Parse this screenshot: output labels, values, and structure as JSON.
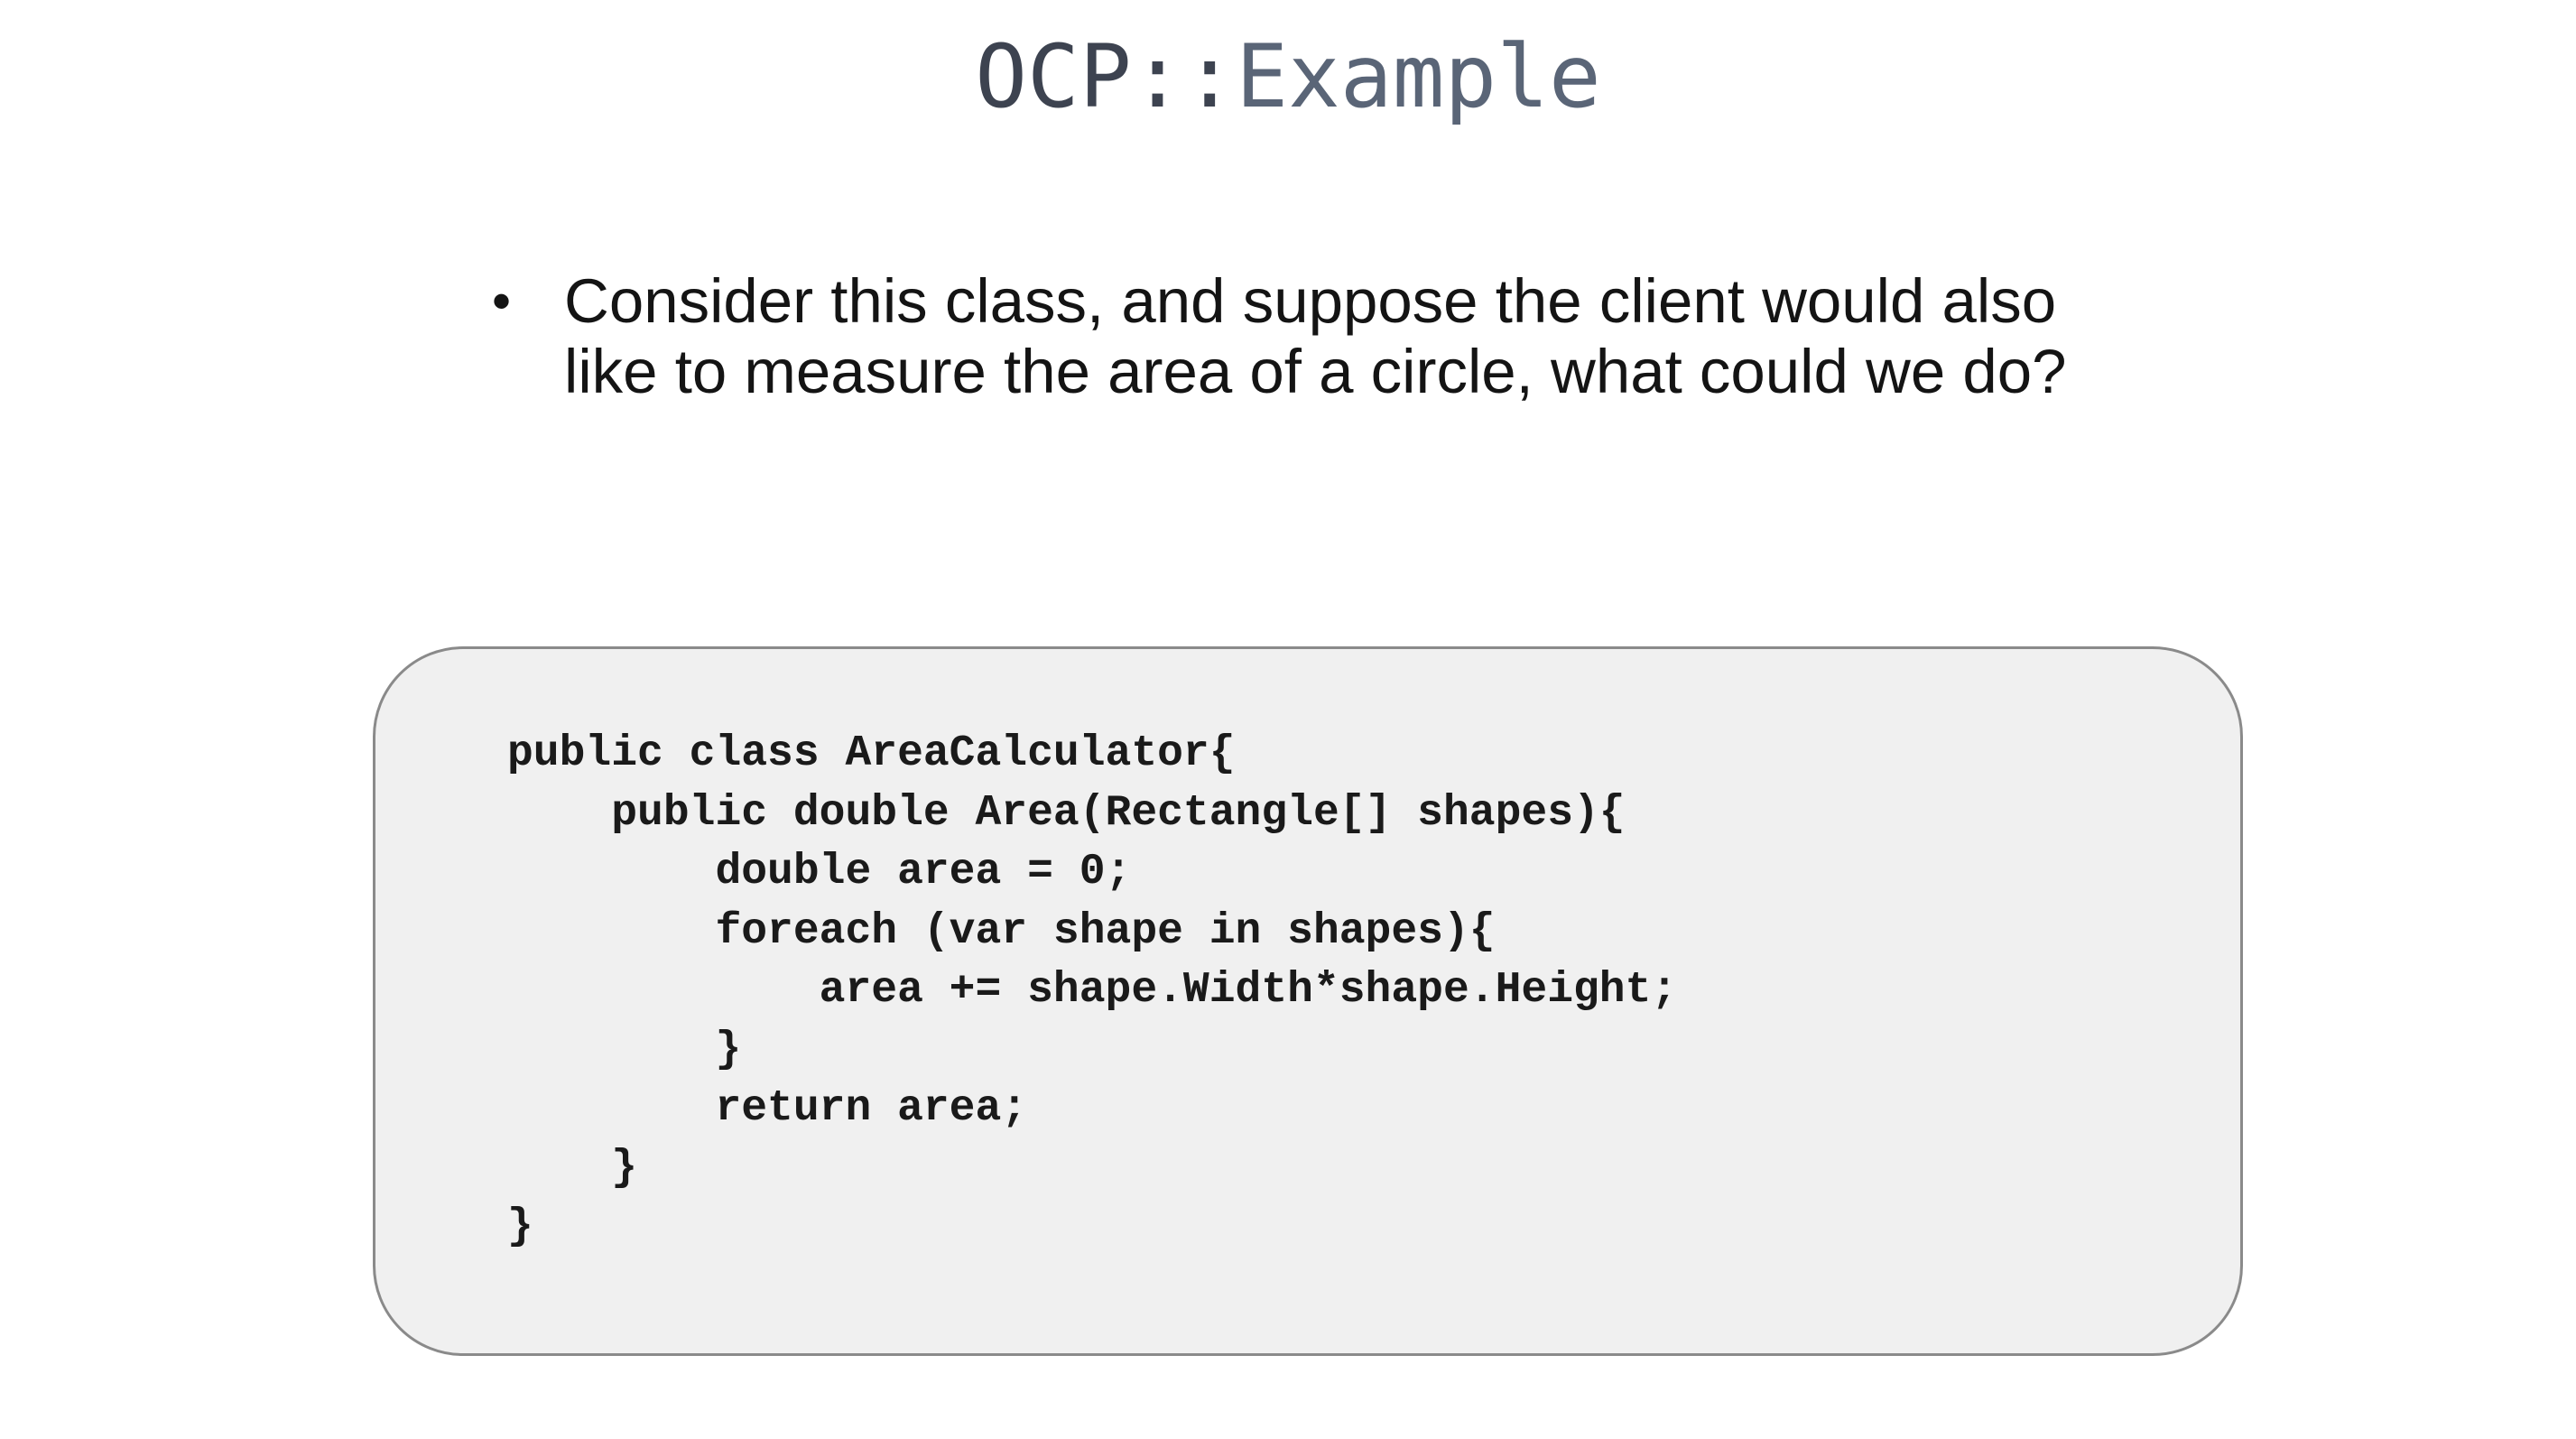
{
  "slide": {
    "title_prefix": "OCP::",
    "title_suffix": "Example",
    "bullet_symbol": "•",
    "bullet_text": "Consider this class, and suppose the client would also like to measure the area of a circle, what could we do?",
    "code_lines": [
      "public class AreaCalculator{",
      "    public double Area(Rectangle[] shapes){",
      "        double area = 0;",
      "        foreach (var shape in shapes){",
      "            area += shape.Width*shape.Height;",
      "        }",
      "        return area;",
      "    }",
      "}"
    ]
  }
}
